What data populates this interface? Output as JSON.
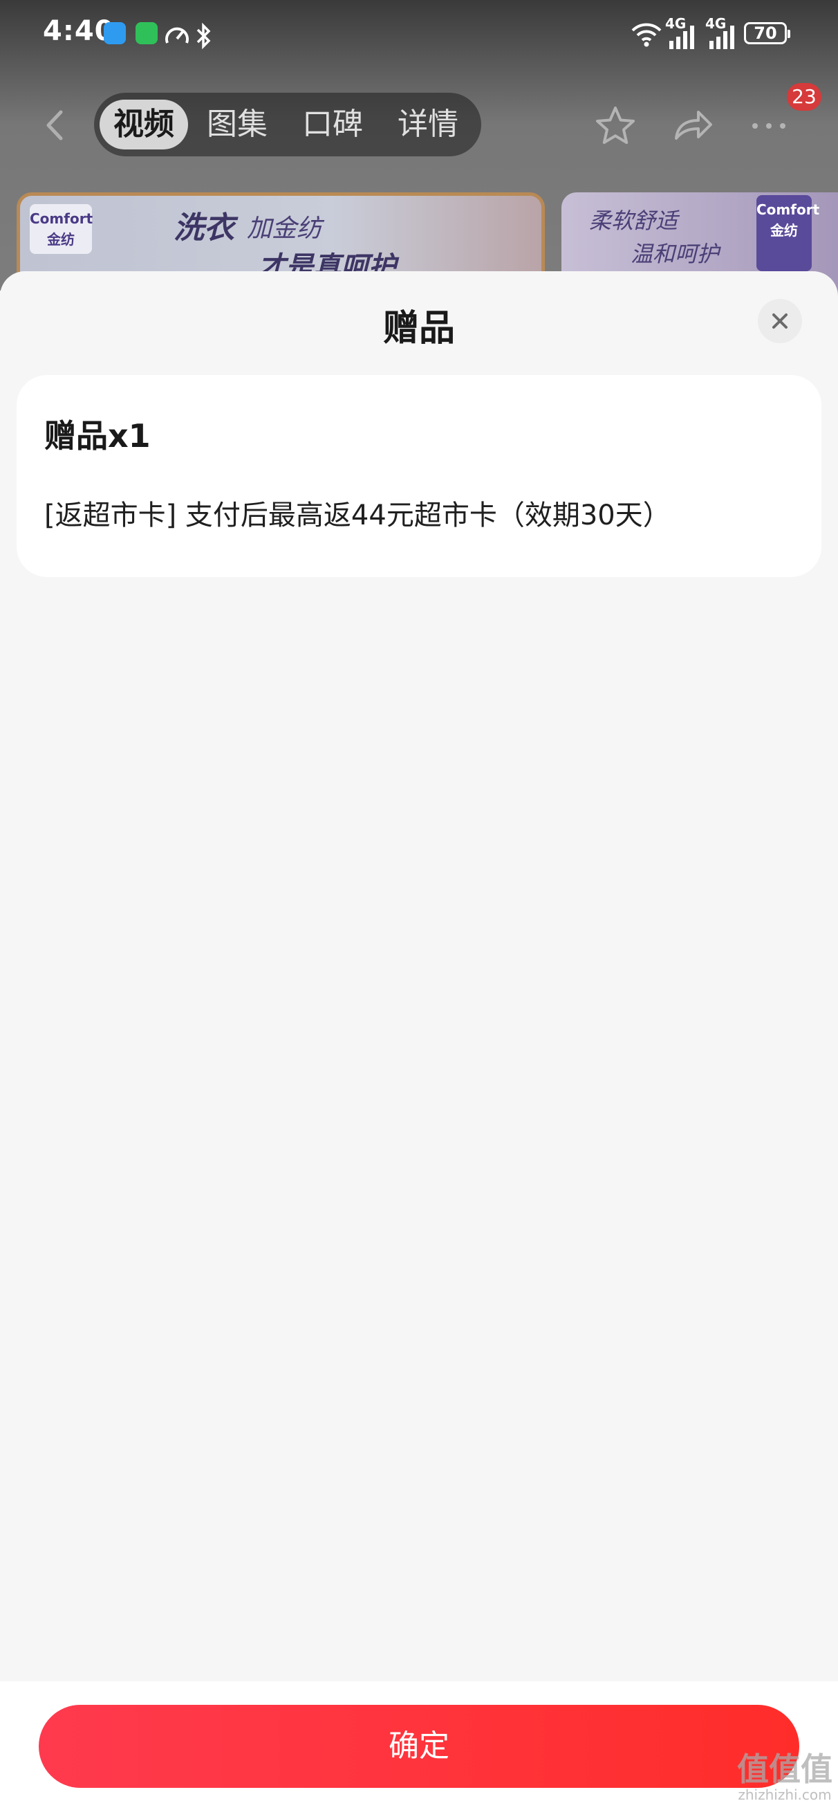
{
  "status_bar": {
    "time": "4:40",
    "network_labels": [
      "4G",
      "4G"
    ],
    "battery": "70"
  },
  "nav": {
    "tabs": [
      {
        "label": "视频",
        "active": true
      },
      {
        "label": "图集",
        "active": false
      },
      {
        "label": "口碑",
        "active": false
      },
      {
        "label": "详情",
        "active": false
      }
    ],
    "more_badge": "23"
  },
  "banner": {
    "left_brand": "Comfort",
    "left_brand_cn": "金纺",
    "left_line1": "洗衣",
    "left_line1b": "加金纺",
    "left_line2": "才是真呵护",
    "right_line1": "柔软舒适",
    "right_line2": "温和呵护",
    "right_brand": "Comfort",
    "right_brand_cn": "金纺"
  },
  "sheet": {
    "title": "赠品",
    "gift": {
      "count_label": "赠品x1",
      "description": "[返超市卡] 支付后最高返44元超市卡（效期30天）"
    },
    "confirm_label": "确定"
  },
  "watermark": {
    "logo": "值值值",
    "url": "zhizhizhi.com"
  },
  "colors": {
    "accent_start": "#ff3a4e",
    "accent_end": "#ff2d2a",
    "badge": "#d63a3a"
  }
}
